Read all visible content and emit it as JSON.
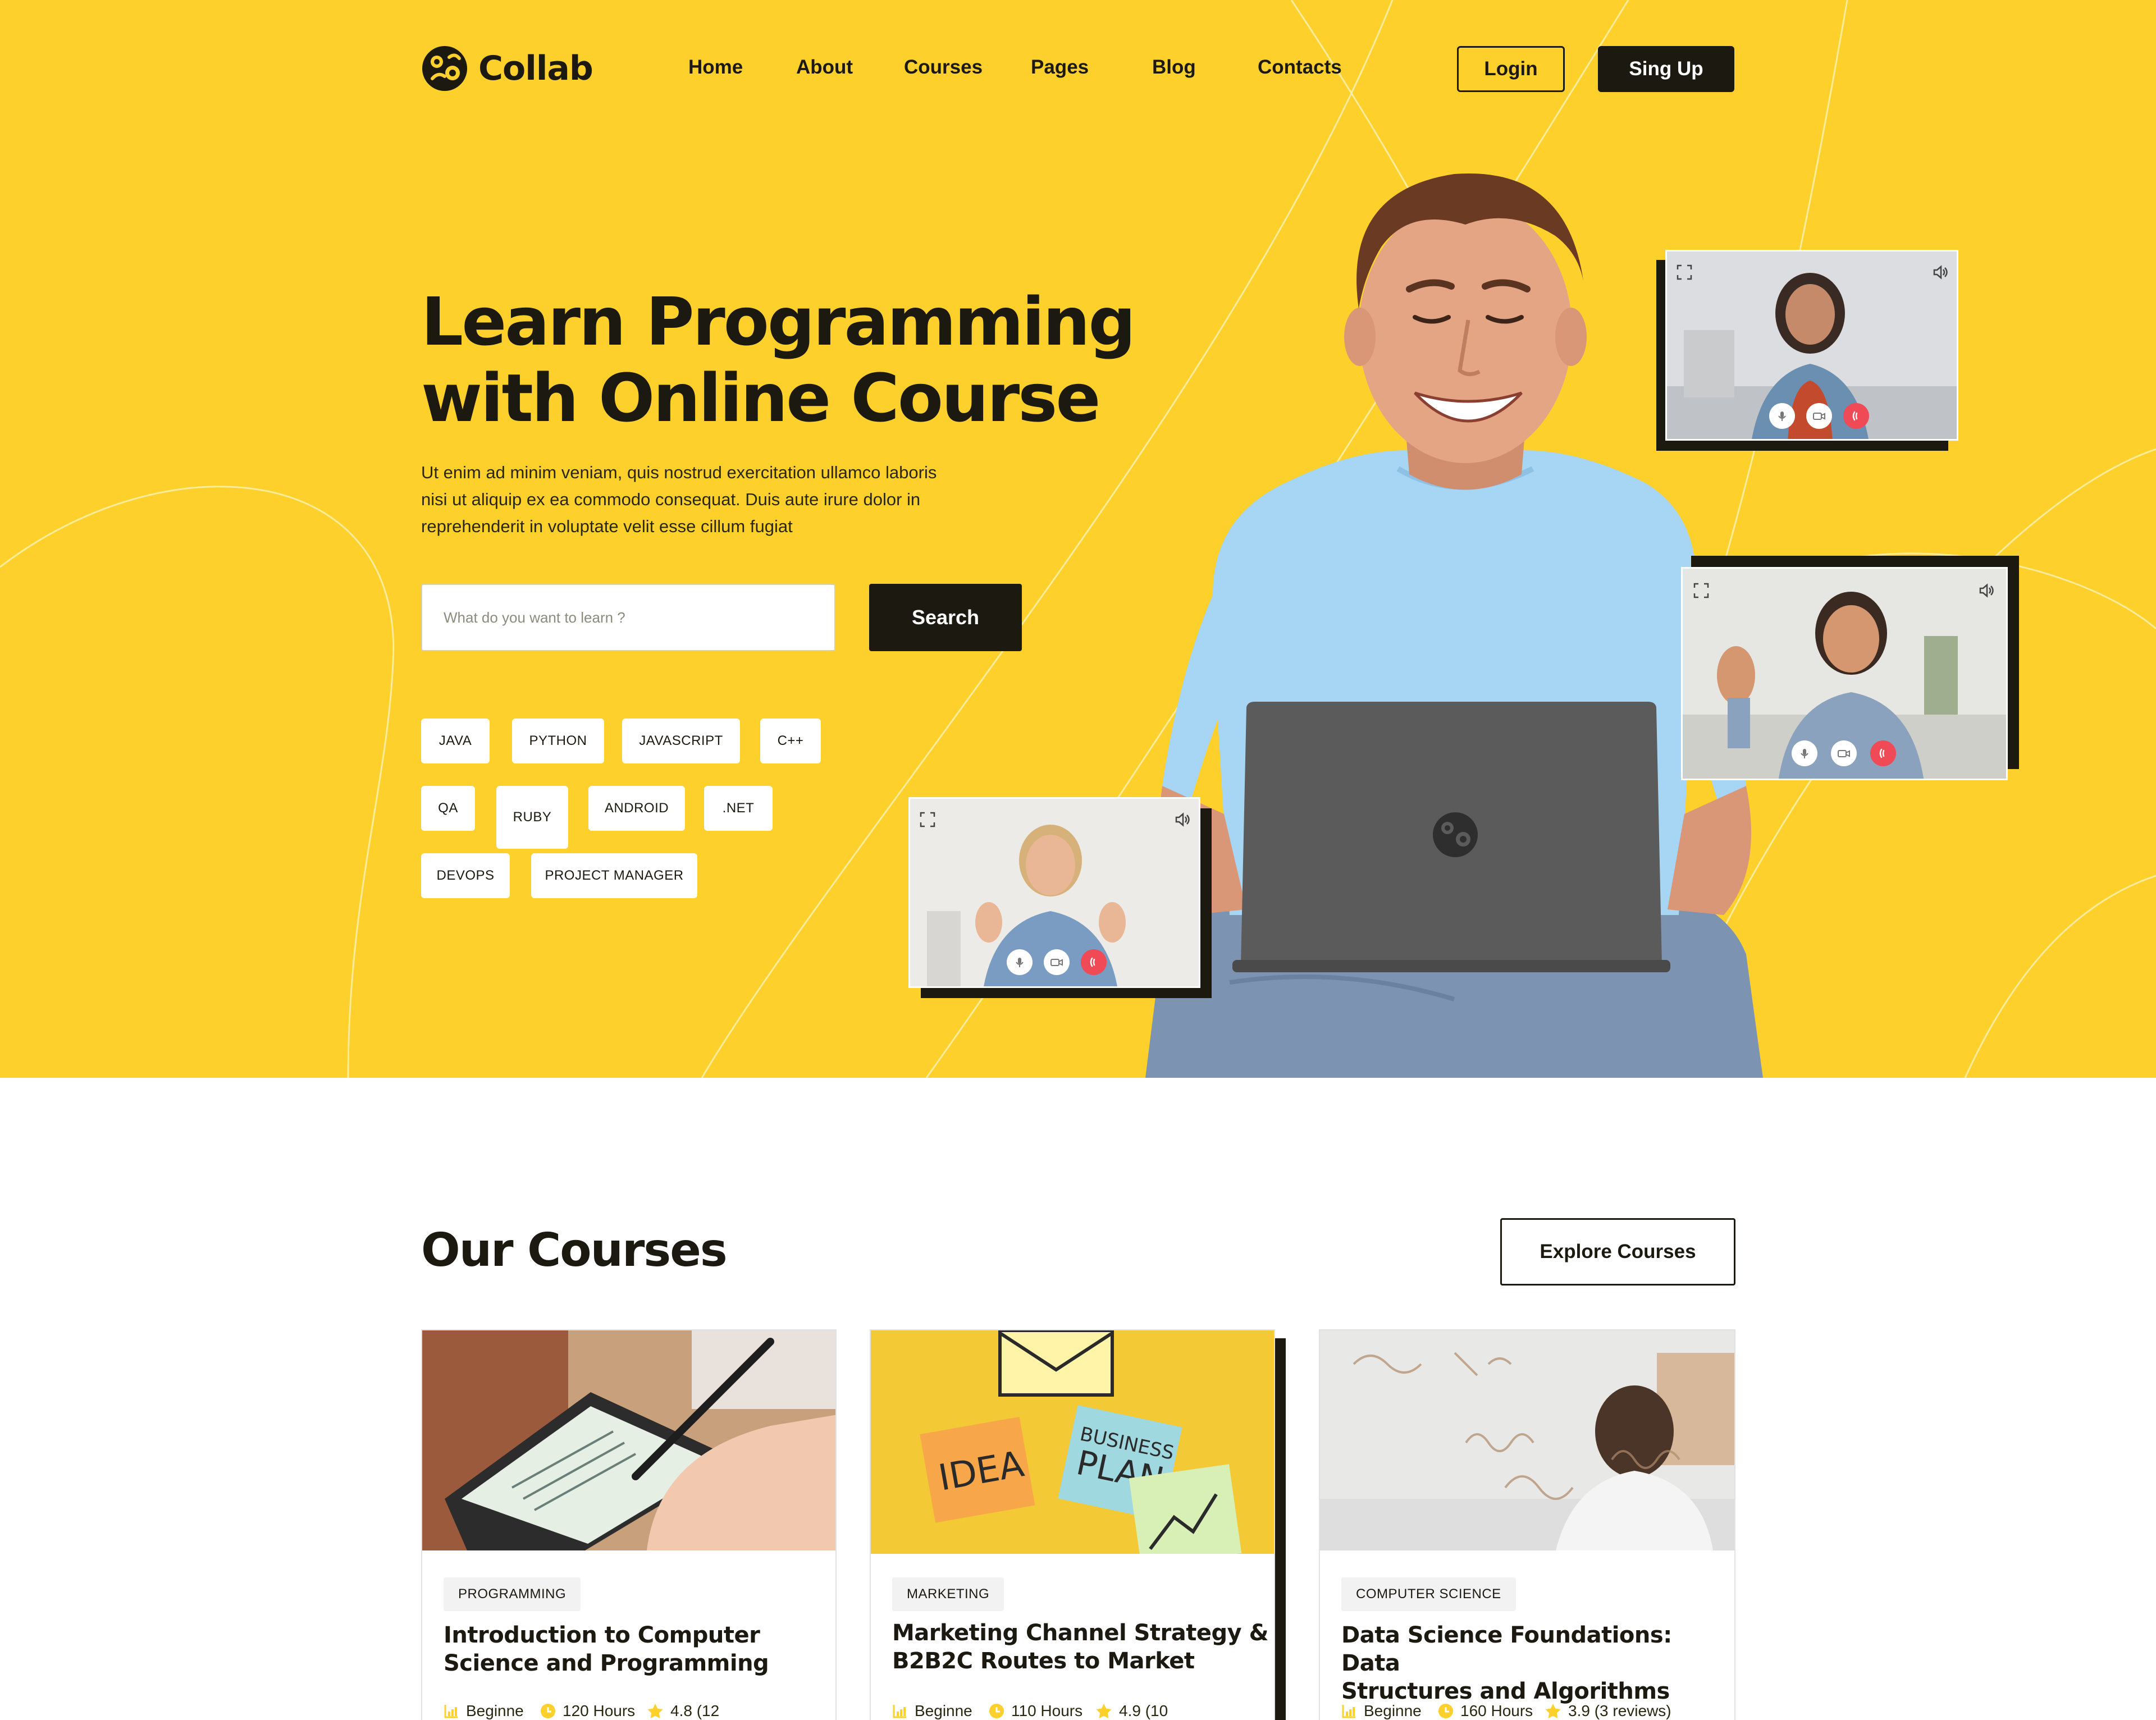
{
  "header": {
    "logo_text": "Collab",
    "nav": [
      "Home",
      "About",
      "Courses",
      "Pages",
      "Blog",
      "Contacts"
    ],
    "login_label": "Login",
    "signup_label": "Sing Up"
  },
  "hero": {
    "title_line1": "Learn Programming",
    "title_line2": "with Online Course",
    "description_line1": "Ut enim ad minim veniam, quis nostrud exercitation ullamco laboris",
    "description_line2": "nisi ut aliquip ex ea commodo consequat. Duis aute irure dolor in",
    "description_line3": "reprehenderit in voluptate velit esse cillum fugiat",
    "search_placeholder": "What do you want to learn ?",
    "search_label": "Search",
    "tags": [
      "JAVA",
      "PYTHON",
      "JAVASCRIPT",
      "C++",
      "QA",
      "RUBY",
      "ANDROID",
      ".NET",
      "DEVOPS",
      "PROJECT MANAGER"
    ]
  },
  "courses": {
    "title": "Our Courses",
    "explore_label": "Explore Courses",
    "items": [
      {
        "category": "PROGRAMMING",
        "title_line1": "Introduction to Computer",
        "title_line2": "Science and Programming",
        "level": "Beginne",
        "hours": "120 Hours",
        "rating": "4.8 (12"
      },
      {
        "category": "MARKETING",
        "title_line1": "Marketing Channel Strategy &",
        "title_line2": "B2B2C Routes to Market",
        "level": "Beginne",
        "hours": "110 Hours",
        "rating": "4.9 (10"
      },
      {
        "category": "COMPUTER SCIENCE",
        "title_line1": "Data Science Foundations: Data",
        "title_line2": "Structures and Algorithms",
        "level": "Beginne",
        "hours": "160 Hours",
        "rating": "3.9 (3 reviews)"
      }
    ]
  },
  "image_texts": {
    "sticky_idea": "IDEA",
    "sticky_business": "BUSINESS",
    "sticky_plan": "PLAN"
  },
  "colors": {
    "brand_yellow": "#fdd02c",
    "dark": "#1c1a10",
    "end_call_red": "#ef4a55"
  },
  "icons": [
    "logo-mark-icon",
    "expand-icon",
    "speaker-icon",
    "mic-icon",
    "camera-icon",
    "end-call-icon",
    "level-bars-icon",
    "clock-icon",
    "star-icon"
  ]
}
